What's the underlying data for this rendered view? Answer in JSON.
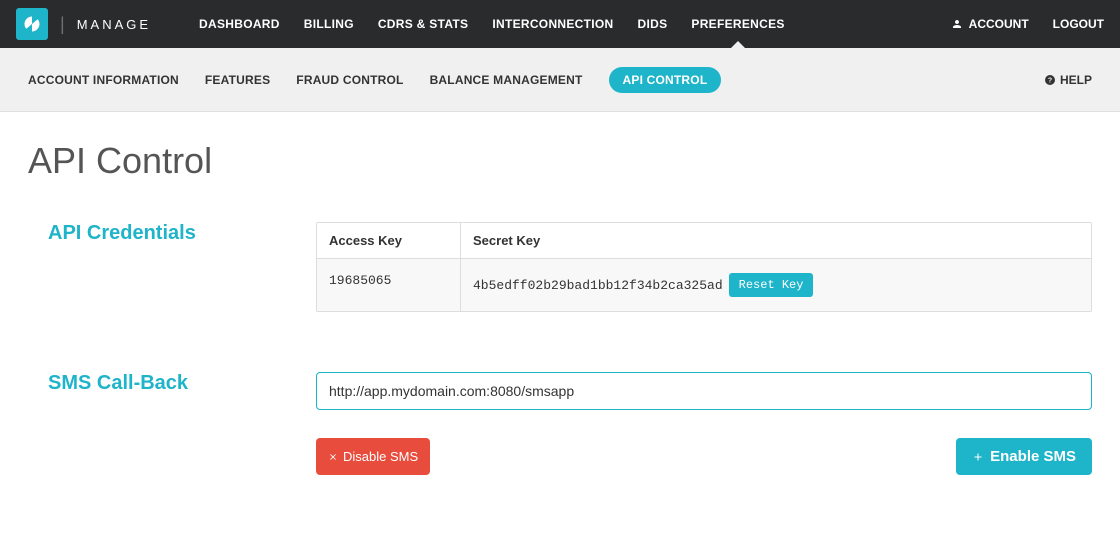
{
  "brand": "MANAGE",
  "nav": {
    "items": [
      "DASHBOARD",
      "BILLING",
      "CDRS & STATS",
      "INTERCONNECTION",
      "DIDS",
      "PREFERENCES"
    ],
    "active_index": 5,
    "account_label": "ACCOUNT",
    "logout_label": "LOGOUT"
  },
  "subnav": {
    "items": [
      "ACCOUNT INFORMATION",
      "FEATURES",
      "FRAUD CONTROL",
      "BALANCE MANAGEMENT",
      "API CONTROL"
    ],
    "active_index": 4,
    "help_label": "HELP"
  },
  "page_title": "API Control",
  "credentials": {
    "section_label": "API Credentials",
    "headers": {
      "access_key": "Access Key",
      "secret_key": "Secret Key"
    },
    "access_key": "19685065",
    "secret_key": "4b5edff02b29bad1bb12f34b2ca325ad",
    "reset_label": "Reset Key"
  },
  "sms": {
    "section_label": "SMS Call-Back",
    "callback_value": "http://app.mydomain.com:8080/smsapp",
    "disable_label": "Disable SMS",
    "enable_label": "Enable SMS"
  },
  "colors": {
    "accent": "#1eb4c9",
    "danger": "#e74c3c"
  }
}
